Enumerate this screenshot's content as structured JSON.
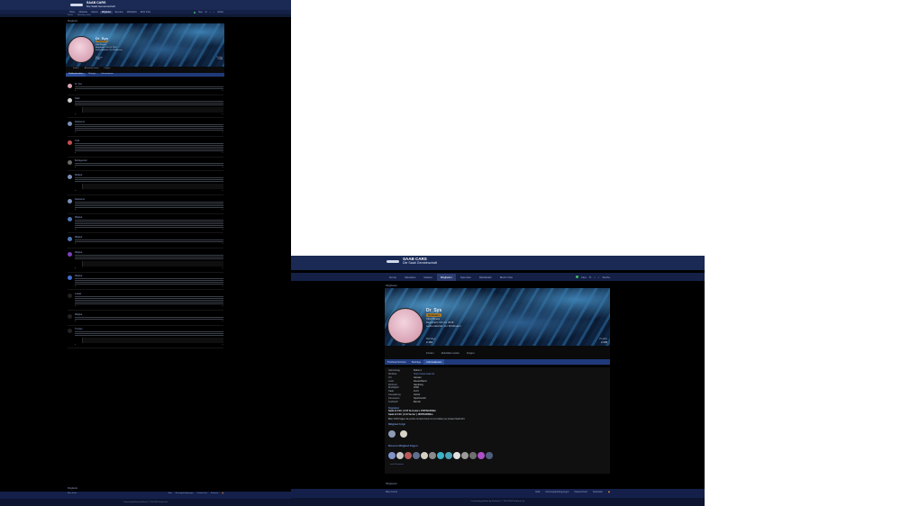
{
  "site": {
    "title": "SAAB CARS",
    "subtitle": "Die Saab Gemeinschaft"
  },
  "nav": {
    "tabs": [
      "Home",
      "Aktuelles",
      "Galerie",
      "Mitglieder",
      "Spenden",
      "Marktplatz",
      "Mehr Infos"
    ],
    "active": "Mitglieder",
    "right": {
      "posts_label": "Neu",
      "search_label": "Suche"
    }
  },
  "breadcrumb": "Mitglieder",
  "profile": {
    "name": "Dr_Sys",
    "badge": "Moderator",
    "meta": [
      "Vital Fitness",
      "Registriert: Okt 23, 2018",
      "Letzte Aktivität: Vor 38 Minuten"
    ],
    "stats": [
      {
        "label": "Beiträge",
        "value": "2.162"
      },
      {
        "label": "Punkte",
        "value": "2.236"
      }
    ],
    "actions": [
      "Finden",
      "Aktivitäten teilen",
      "Folgen"
    ],
    "tabs_left": [
      "Profilnachrichten",
      "Beiträge",
      "Informationen"
    ],
    "tabs_right": [
      "Profilnachrichten",
      "Beiträge",
      "Informationen"
    ]
  },
  "about": {
    "rows": [
      {
        "k": "Geburtstag",
        "v": "Rufus 1"
      },
      {
        "k": "Website",
        "v": "https://www.saab.de",
        "link": true
      },
      {
        "k": "Ort",
        "v": "Hessen"
      },
      {
        "k": "Land",
        "v": "Deutschland"
      },
      {
        "k": "Wohnort",
        "v": "Hamburg"
      },
      {
        "k": "Modelljahr",
        "v": "2006"
      },
      {
        "k": "Saab",
        "v": "9-3 II"
      },
      {
        "k": "Ausstattung",
        "v": "Vector"
      },
      {
        "k": "Karosserie",
        "v": "SportCombi"
      },
      {
        "k": "Kraftstoff",
        "v": "Benzin"
      }
    ],
    "signature_title": "Signatur",
    "signature_lines": [
      "Saab 9-3 SC | 2.0T B-Linear | 150PS/240Nm",
      "Saab 9-5 SC | 2.3t Vector | 185PS/280Nm"
    ],
    "signature_note": "Bitte VOR Fragen die suche mit dem Forum zu tun haben per privater Nachricht",
    "following_title": "Mitglied folgt",
    "followers_title": "Diesem Mitglied folgen",
    "followers_more": "... und 10 weitere"
  },
  "feed": [
    {
      "who": "Dr_Sys",
      "color": "#d9a3b5"
    },
    {
      "who": "Saab",
      "color": "#cfcfcf"
    },
    {
      "who": "Danksund",
      "color": "#7a8fb8"
    },
    {
      "who": "Trolli",
      "color": "#c94e4e"
    },
    {
      "who": "Beitragender",
      "color": "#6b6b6b"
    },
    {
      "who": "Mitglied",
      "color": "#7a8fb8"
    },
    {
      "who": "Danksund",
      "color": "#7a8fb8"
    },
    {
      "who": "Mitglied",
      "color": "#4f77b9"
    },
    {
      "who": "Mitglied",
      "color": "#4f77b9"
    },
    {
      "who": "Mitglied",
      "color": "#7f3fbf"
    },
    {
      "who": "Mitglied",
      "color": "#3f6fd1"
    },
    {
      "who": "Loader",
      "color": "#222"
    },
    {
      "who": "Mitglied",
      "color": "#222"
    },
    {
      "who": "Trocken",
      "color": "#222"
    }
  ],
  "footer": {
    "left": "Mein Konto",
    "links": [
      "Hilfe",
      "Nutzungsbedingungen",
      "Datenschutz",
      "Startseite"
    ],
    "copyright": "Community platform by XenForo® © 2010-2023 XenForo Ltd."
  }
}
